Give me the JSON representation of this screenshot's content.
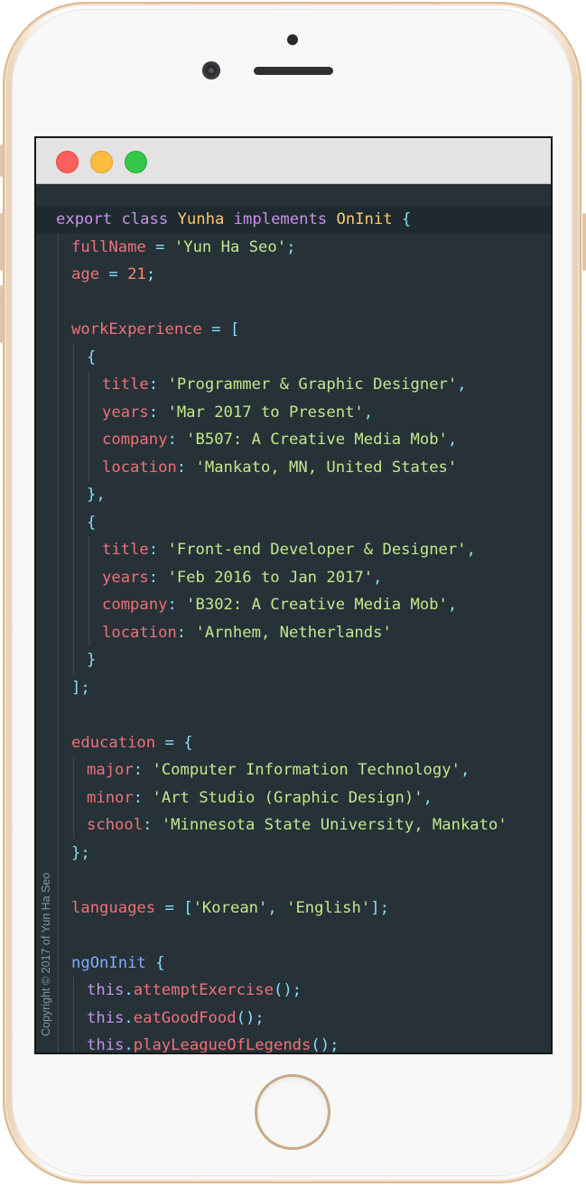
{
  "window": {
    "controls": [
      {
        "name": "close",
        "color": "#fc605c"
      },
      {
        "name": "minimize",
        "color": "#fdbc40"
      },
      {
        "name": "maximize",
        "color": "#34c84a"
      }
    ]
  },
  "code": {
    "theme": {
      "keyword": "#c792ea",
      "class": "#ffcb6b",
      "property": "#f07178",
      "function": "#82aaff",
      "string": "#c3e88d",
      "number": "#f78c6c",
      "punctuation": "#89ddff",
      "background": "#263238"
    },
    "lines": [
      {
        "text": "export class Yunha implements OnInit {",
        "indent": 0,
        "highlight": true
      },
      {
        "text": "fullName = 'Yun Ha Seo';",
        "indent": 1
      },
      {
        "text": "age = 21;",
        "indent": 1
      },
      {
        "text": "",
        "indent": 1
      },
      {
        "text": "workExperience = [",
        "indent": 1
      },
      {
        "text": "{",
        "indent": 2
      },
      {
        "text": "title: 'Programmer & Graphic Designer',",
        "indent": 3
      },
      {
        "text": "years: 'Mar 2017 to Present',",
        "indent": 3
      },
      {
        "text": "company: 'B507: A Creative Media Mob',",
        "indent": 3
      },
      {
        "text": "location: 'Mankato, MN, United States'",
        "indent": 3
      },
      {
        "text": "},",
        "indent": 2
      },
      {
        "text": "{",
        "indent": 2
      },
      {
        "text": "title: 'Front-end Developer & Designer',",
        "indent": 3
      },
      {
        "text": "years: 'Feb 2016 to Jan 2017',",
        "indent": 3
      },
      {
        "text": "company: 'B302: A Creative Media Mob',",
        "indent": 3
      },
      {
        "text": "location: 'Arnhem, Netherlands'",
        "indent": 3
      },
      {
        "text": "}",
        "indent": 2
      },
      {
        "text": "];",
        "indent": 1
      },
      {
        "text": "",
        "indent": 1
      },
      {
        "text": "education = {",
        "indent": 1
      },
      {
        "text": "major: 'Computer Information Technology',",
        "indent": 2
      },
      {
        "text": "minor: 'Art Studio (Graphic Design)',",
        "indent": 2
      },
      {
        "text": "school: 'Minnesota State University, Mankato'",
        "indent": 2
      },
      {
        "text": "};",
        "indent": 1
      },
      {
        "text": "",
        "indent": 1
      },
      {
        "text": "languages = ['Korean', 'English'];",
        "indent": 1
      },
      {
        "text": "",
        "indent": 1
      },
      {
        "text": "ngOnInit {",
        "indent": 1
      },
      {
        "text": "this.attemptExercise();",
        "indent": 2
      },
      {
        "text": "this.eatGoodFood();",
        "indent": 2
      },
      {
        "text": "this.playLeagueOfLegends();",
        "indent": 2
      }
    ]
  },
  "footer": {
    "copyright": "Copyright © 2017 of Yun Ha Seo"
  }
}
